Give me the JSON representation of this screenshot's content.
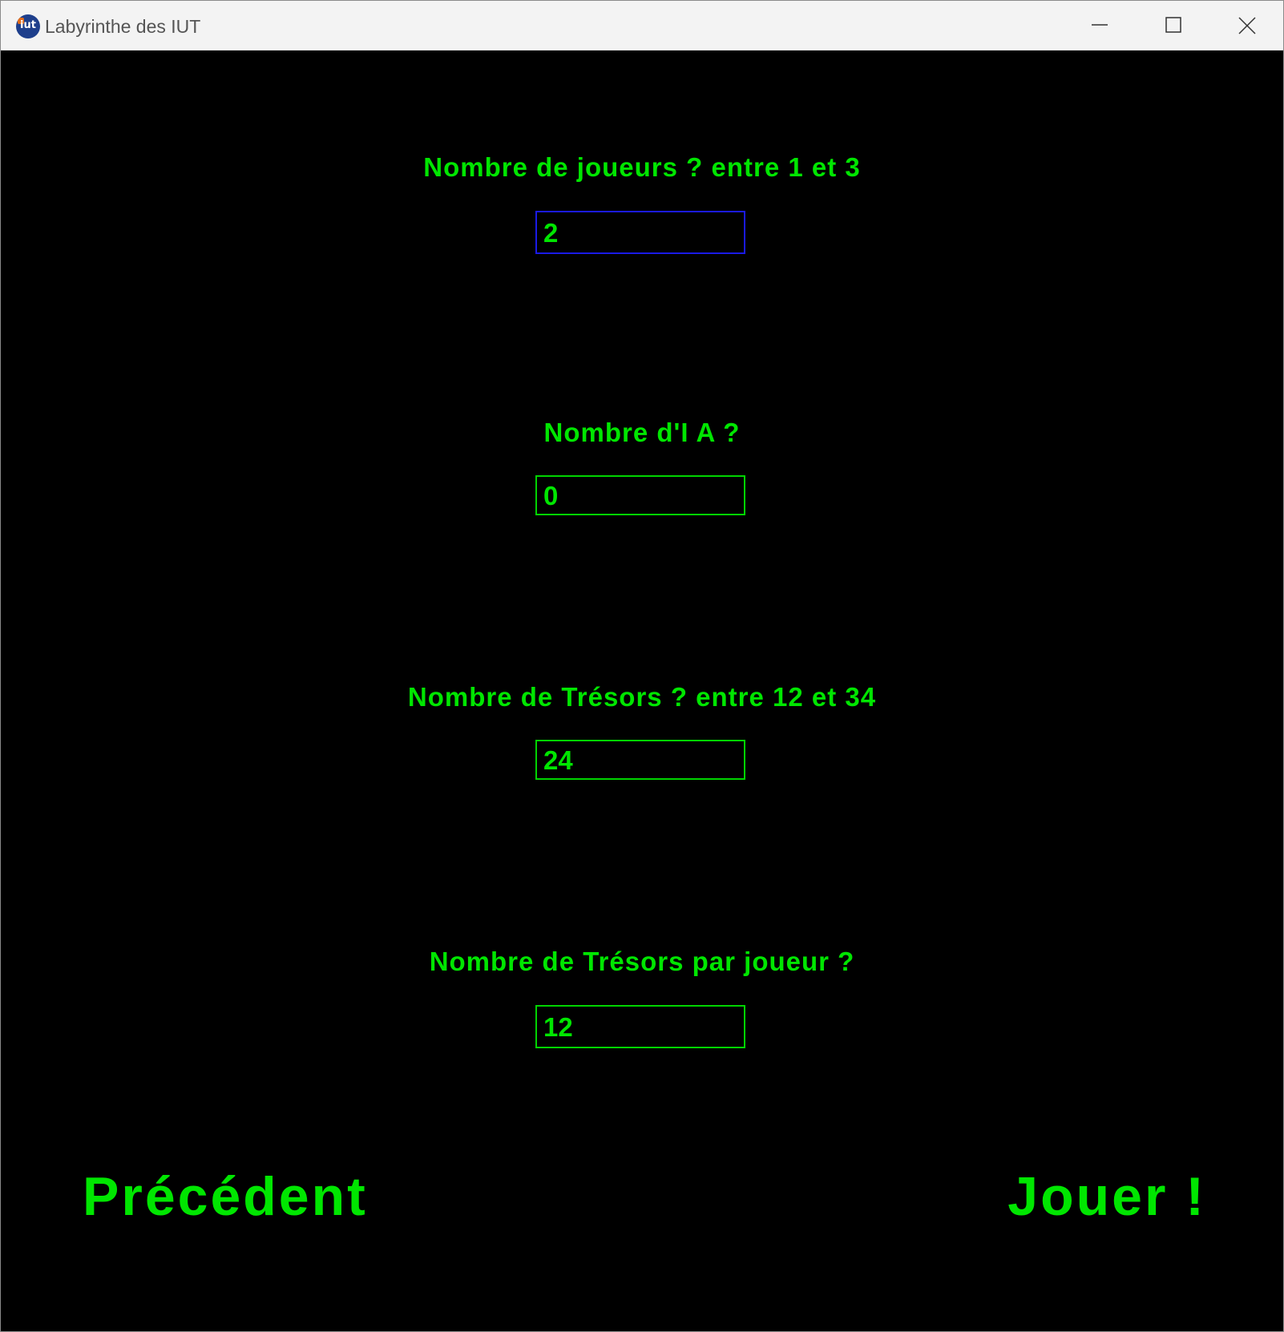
{
  "window": {
    "title": "Labyrinthe des IUT",
    "icon": "iut-logo-icon",
    "icon_text": "iut",
    "controls": [
      "minimize-icon",
      "maximize-icon",
      "close-icon"
    ]
  },
  "form": {
    "players": {
      "label": "Nombre de joueurs ? entre 1 et 3",
      "value": "2"
    },
    "ai": {
      "label": "Nombre d'I A ?",
      "value": "0"
    },
    "treasures": {
      "label": "Nombre de Trésors ? entre 12 et 34",
      "value": "24"
    },
    "treasures_per_player": {
      "label": "Nombre de Trésors par joueur ?",
      "value": "12"
    }
  },
  "nav": {
    "previous_label": "Précédent",
    "play_label": "Jouer !"
  },
  "colors": {
    "background": "#000000",
    "text": "#00e600",
    "field_border": "#00d400",
    "focused_border": "#1a1ae6"
  }
}
